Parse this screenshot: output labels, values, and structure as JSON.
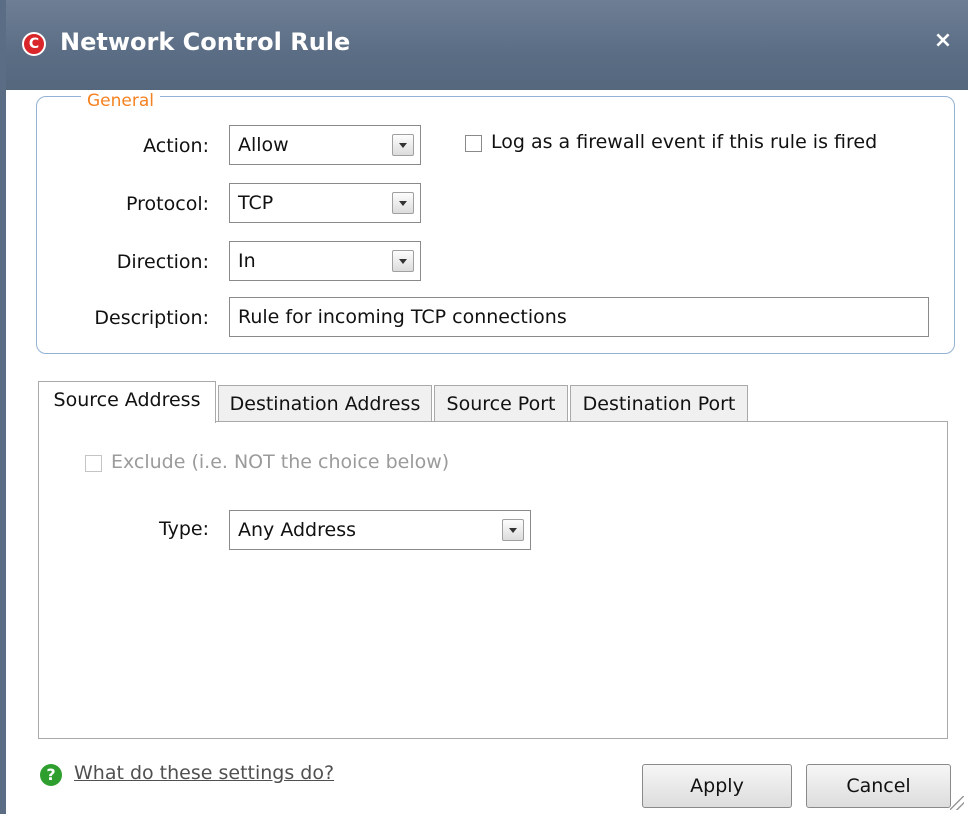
{
  "window": {
    "title": "Network Control Rule",
    "close_glyph": "×",
    "app_icon": "comodo-logo-icon",
    "app_icon_letter": "C"
  },
  "general": {
    "legend": "General",
    "action": {
      "label": "Action:",
      "value": "Allow"
    },
    "log_checkbox": {
      "label": "Log as a firewall event if this rule is fired",
      "checked": false
    },
    "protocol": {
      "label": "Protocol:",
      "value": "TCP"
    },
    "direction": {
      "label": "Direction:",
      "value": "In"
    },
    "description": {
      "label": "Description:",
      "value": "Rule for incoming TCP connections"
    }
  },
  "tabs": [
    {
      "label": "Source Address",
      "active": true
    },
    {
      "label": "Destination Address",
      "active": false
    },
    {
      "label": "Source Port",
      "active": false
    },
    {
      "label": "Destination Port",
      "active": false
    }
  ],
  "source_address": {
    "exclude": {
      "label": "Exclude (i.e. NOT the choice below)",
      "checked": false,
      "enabled": false
    },
    "type": {
      "label": "Type:",
      "value": "Any Address"
    }
  },
  "footer": {
    "help_icon_glyph": "?",
    "help_link": "What do these settings do?",
    "apply_label": "Apply",
    "cancel_label": "Cancel"
  },
  "colors": {
    "titlebar": "#5a6d84",
    "legend": "#f58220",
    "group_border": "#93b2d4",
    "help_icon": "#2e9f2e",
    "app_icon": "#d9262b"
  }
}
